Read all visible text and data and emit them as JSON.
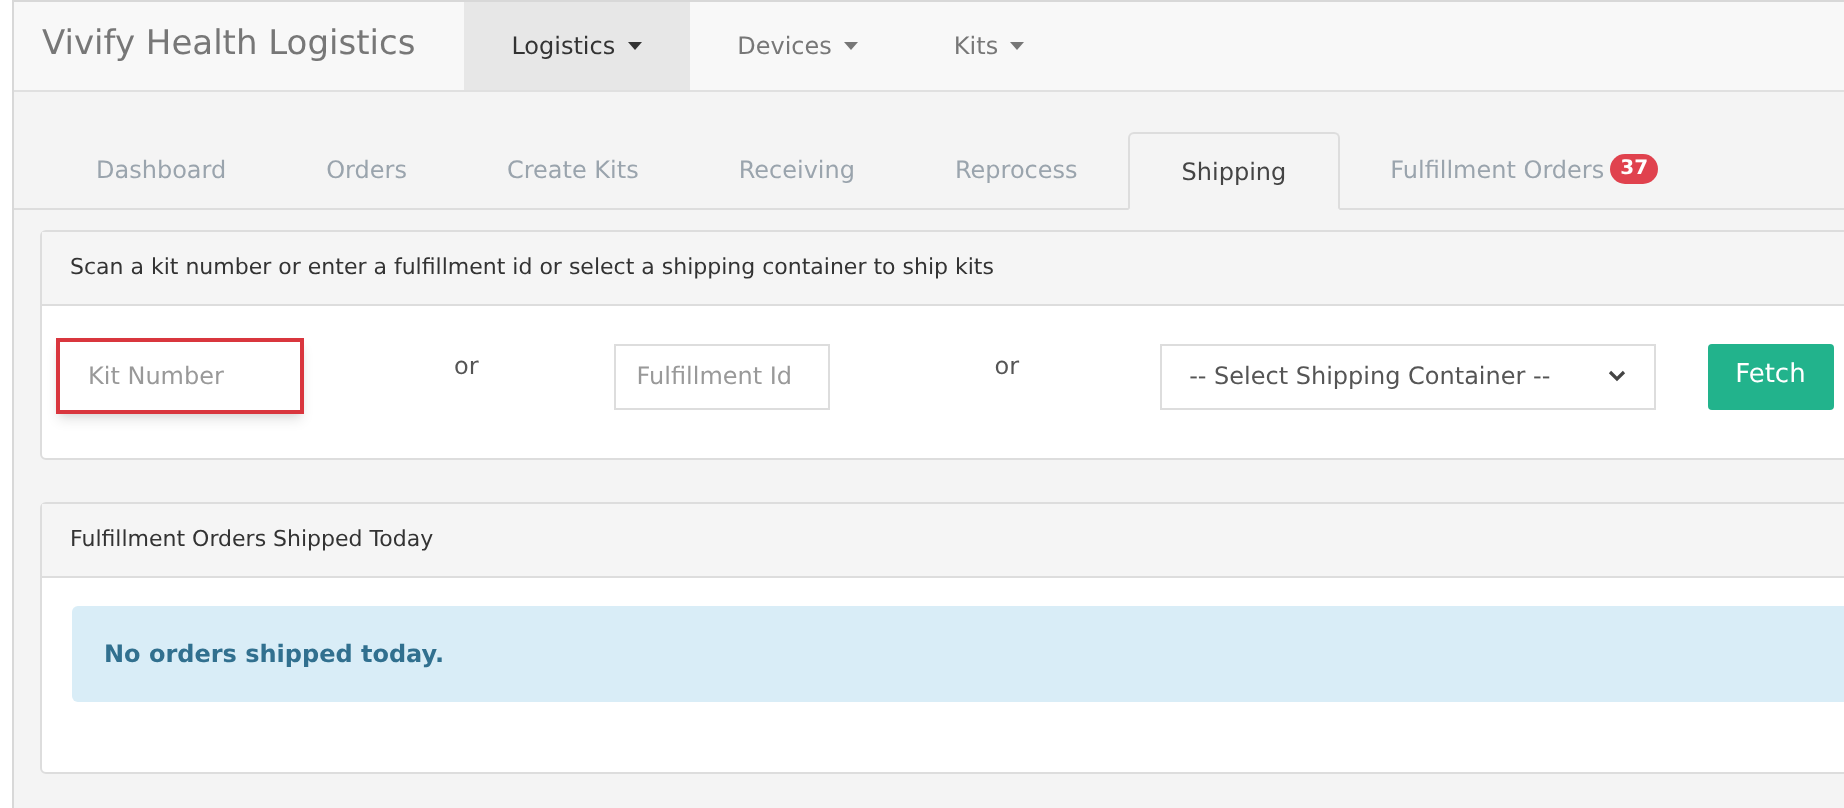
{
  "navbar": {
    "brand": "Vivify Health Logistics",
    "menus": [
      {
        "label": "Logistics",
        "selected": true
      },
      {
        "label": "Devices",
        "selected": false
      },
      {
        "label": "Kits",
        "selected": false
      }
    ]
  },
  "tabs": [
    {
      "label": "Dashboard",
      "selected": false
    },
    {
      "label": "Orders",
      "selected": false
    },
    {
      "label": "Create Kits",
      "selected": false
    },
    {
      "label": "Receiving",
      "selected": false
    },
    {
      "label": "Reprocess",
      "selected": false
    },
    {
      "label": "Shipping",
      "selected": true
    },
    {
      "label": "Fulfillment Orders",
      "selected": false,
      "badge": "37"
    }
  ],
  "ship_panel": {
    "heading": "Scan a kit number or enter a fulfillment id or select a shipping container to ship kits",
    "kit_field": {
      "placeholder": "Kit Number",
      "highlighted": true
    },
    "separator_1": "or",
    "fulfillment_field": {
      "placeholder": "Fulfillment Id"
    },
    "separator_2": "or",
    "container_select": {
      "value": "-- Select Shipping Container --"
    },
    "fetch_button": "Fetch"
  },
  "shipped_panel": {
    "heading": "Fulfillment Orders Shipped Today",
    "message": "No orders shipped today."
  }
}
